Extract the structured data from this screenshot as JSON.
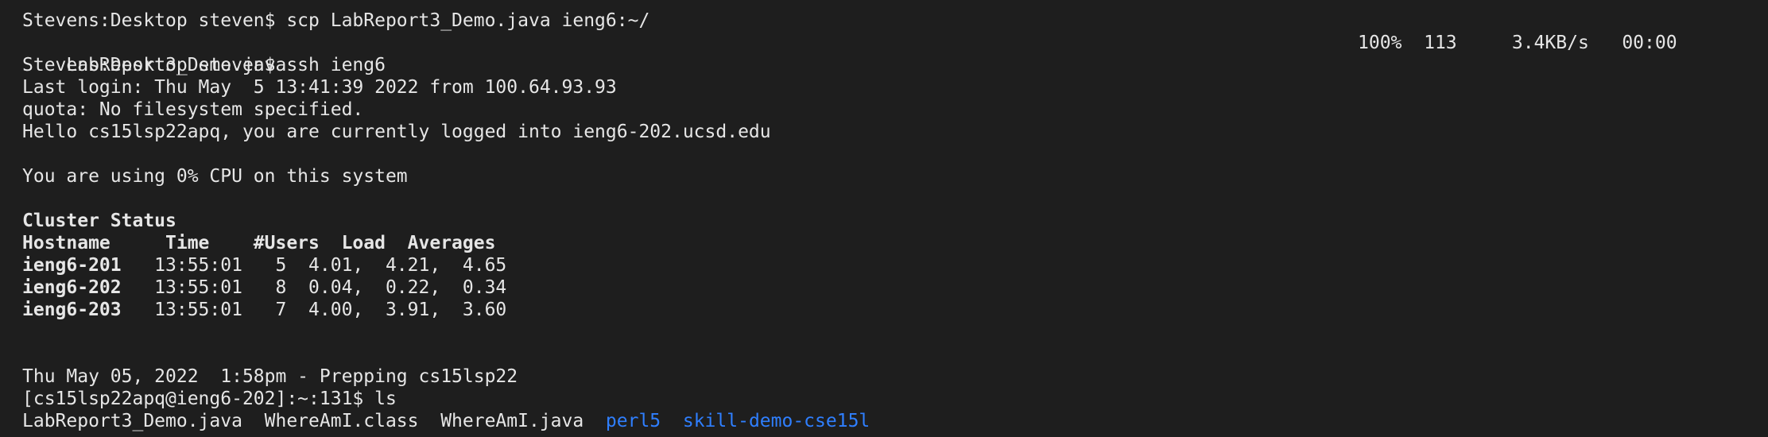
{
  "terminal": {
    "lines": {
      "l1": "Stevens:Desktop steven$ scp LabReport3_Demo.java ieng6:~/",
      "l2_file": "LabReport3_Demo.java",
      "l2_progress": "100%  113     3.4KB/s   00:00",
      "l3": "Stevens:Desktop steven$ ssh ieng6",
      "l4": "Last login: Thu May  5 13:41:39 2022 from 100.64.93.93",
      "l5": "quota: No filesystem specified.",
      "l6": "Hello cs15lsp22apq, you are currently logged into ieng6-202.ucsd.edu",
      "l8": "You are using 0% CPU on this system",
      "l10": "Cluster Status",
      "l11": "Hostname     Time    #Users  Load  Averages",
      "l12_host": "ieng6-201",
      "l12_rest": "   13:55:01   5  4.01,  4.21,  4.65",
      "l13_host": "ieng6-202",
      "l13_rest": "   13:55:01   8  0.04,  0.22,  0.34",
      "l14_host": "ieng6-203",
      "l14_rest": "   13:55:01   7  4.00,  3.91,  3.60",
      "l17": "Thu May 05, 2022  1:58pm - Prepping cs15lsp22",
      "l18": "[cs15lsp22apq@ieng6-202]:~:131$ ls",
      "l19_files": "LabReport3_Demo.java  WhereAmI.class  WhereAmI.java  ",
      "l19_dir1": "perl5",
      "l19_sep": "  ",
      "l19_dir2": "skill-demo-cse15l"
    }
  }
}
